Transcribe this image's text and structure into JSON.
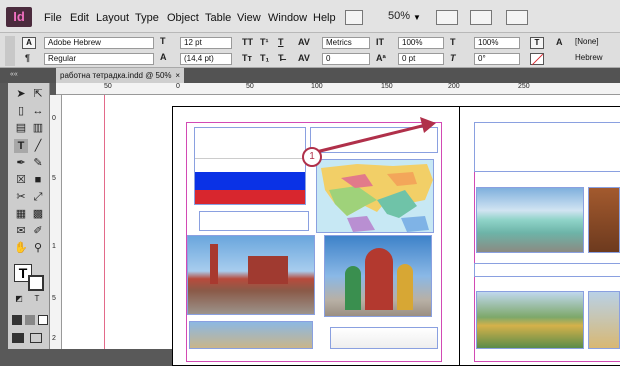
{
  "app": {
    "logo": "Id",
    "zoom": "50%"
  },
  "menu": [
    "File",
    "Edit",
    "Layout",
    "Type",
    "Object",
    "Table",
    "View",
    "Window",
    "Help"
  ],
  "control": {
    "font_family": "Adobe Hebrew",
    "font_style": "Regular",
    "font_size": "12 pt",
    "leading": "(14,4 pt)",
    "kerning": "Metrics",
    "tracking": "0",
    "vscale": "100%",
    "hscale": "100%",
    "baseline": "0 pt",
    "skew": "0°",
    "style_name": "[None]",
    "language": "Hebrew",
    "tt1": "TT",
    "tt2": "T¹",
    "tt3": "T",
    "tt4": "Tᴛ",
    "tt5": "T₁",
    "tt6": "T̶",
    "char_T": "T",
    "char_A": "A"
  },
  "doc_tab": "работна тетрадка.indd @ 50%",
  "ruler": {
    "top": [
      "50",
      "0",
      "50",
      "100",
      "150",
      "200",
      "250"
    ],
    "left": [
      "0",
      "5",
      "1",
      "5",
      "2"
    ]
  },
  "callout": {
    "number": "1"
  },
  "colors": {
    "accent": "#b0304a",
    "russia_white": "#ffffff",
    "russia_blue": "#0a32e6",
    "russia_red": "#d8262e",
    "guide_magenta": "#d24ab4",
    "frame_blue": "#8aa0e0"
  }
}
